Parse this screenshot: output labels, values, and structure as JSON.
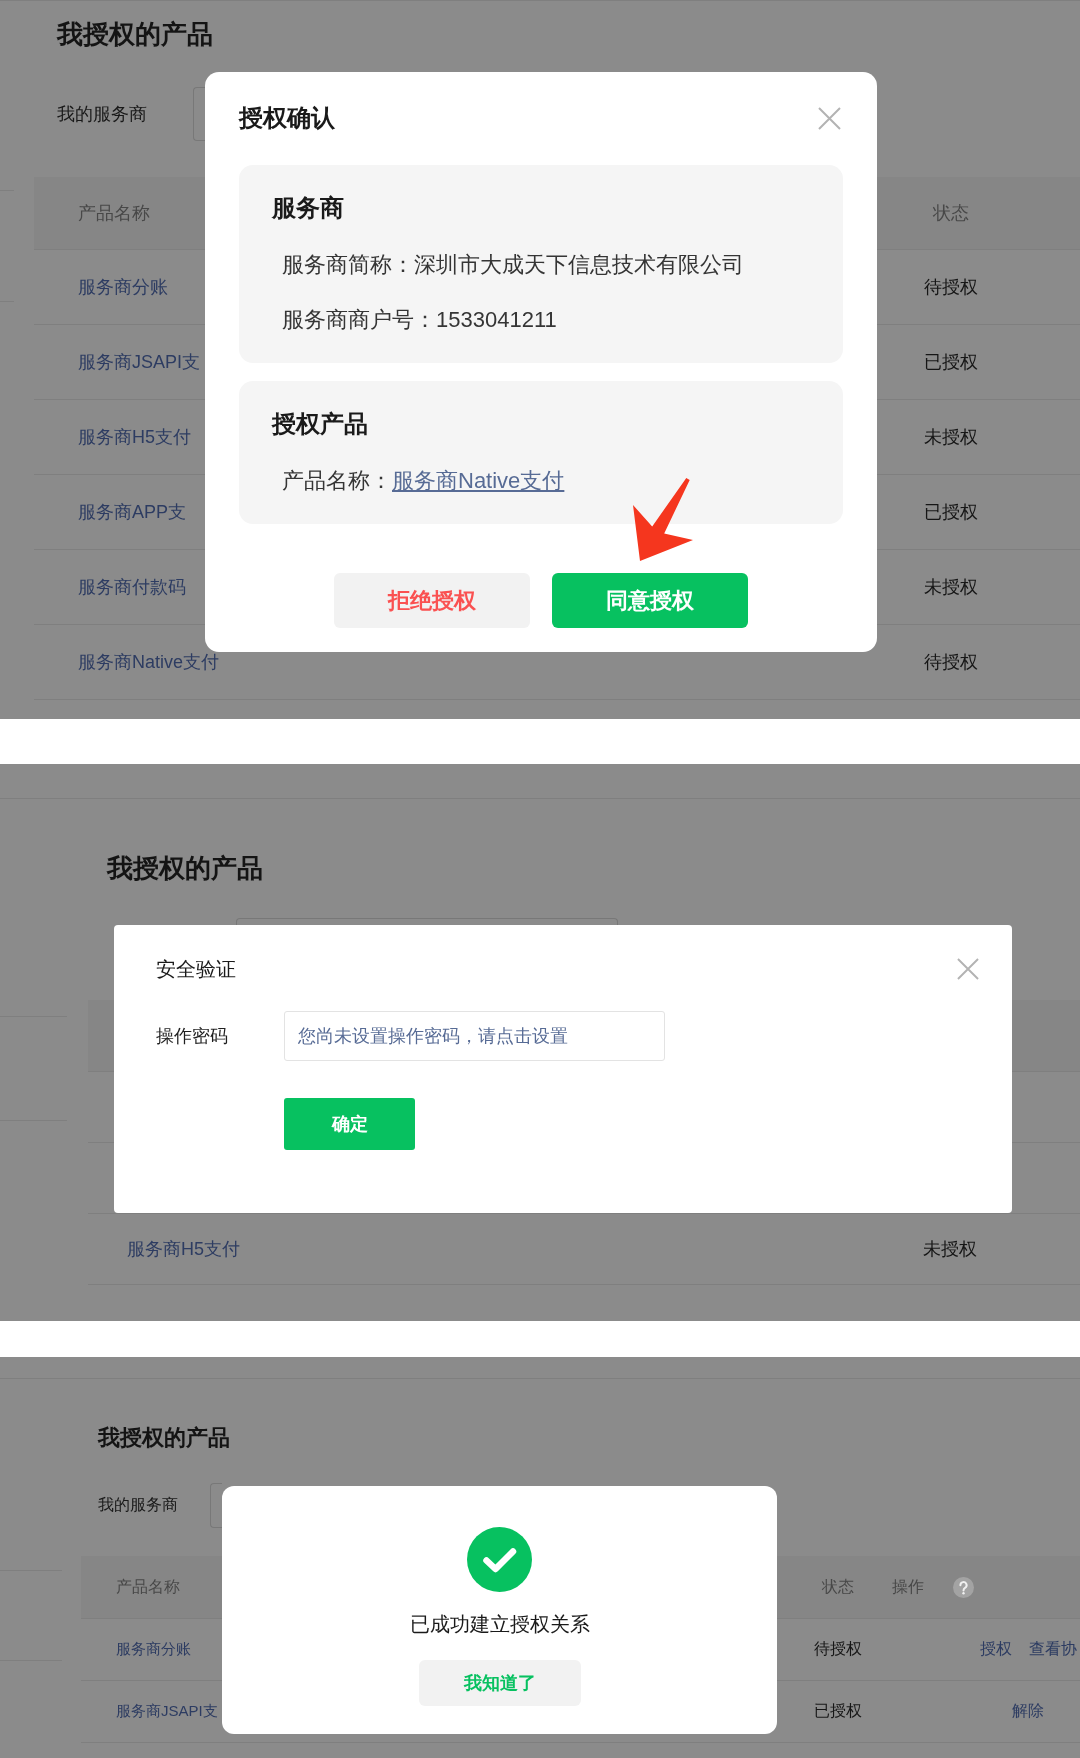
{
  "screens": [
    {
      "kind": "authorize",
      "page": {
        "title": "我授权的产品",
        "filter_label": "我的服务商",
        "columns": [
          {
            "label": "产品名称",
            "help": false
          },
          {
            "label": "状态",
            "help": false
          }
        ],
        "rows": [
          {
            "product": "服务商分账",
            "status": "待授权"
          },
          {
            "product": "服务商JSAPI支",
            "status": "已授权"
          },
          {
            "product": "服务商H5支付",
            "status": "未授权"
          },
          {
            "product": "服务商APP支",
            "status": "已授权"
          },
          {
            "product": "服务商付款码",
            "status": "未授权"
          },
          {
            "product": "服务商Native支付",
            "status": "待授权"
          }
        ]
      },
      "dialog": {
        "title": "授权确认",
        "sections": [
          {
            "heading": "服务商",
            "lines": [
              {
                "label": "服务商简称：",
                "value": "深圳市大成天下信息技术有限公司",
                "kind": "text"
              },
              {
                "label": "服务商商户号：",
                "value": "1533041211",
                "kind": "text"
              }
            ]
          },
          {
            "heading": "授权产品",
            "lines": [
              {
                "label": "产品名称：",
                "value": "服务商Native支付",
                "kind": "link"
              }
            ]
          }
        ],
        "buttons": [
          {
            "label": "拒绝授权",
            "kind": "reject"
          },
          {
            "label": "同意授权",
            "kind": "primary"
          }
        ]
      }
    },
    {
      "kind": "verify",
      "page": {
        "title": "我授权的产品",
        "rows": [
          {
            "product": "服务商H5支付",
            "status": "未授权"
          }
        ]
      },
      "dialog": {
        "title": "安全验证",
        "field_label": "操作密码",
        "field_link": "您尚未设置操作密码，请点击设置",
        "button": "确定"
      }
    },
    {
      "kind": "success",
      "page": {
        "title": "我授权的产品",
        "filter_label": "我的服务商",
        "columns": [
          {
            "label": "产品名称",
            "help": false
          },
          {
            "label": "状态",
            "help": false
          },
          {
            "label": "操作",
            "help": true
          }
        ],
        "rows": [
          {
            "product": "服务商分账",
            "status": "待授权",
            "actions": [
              "授权",
              "查看协"
            ]
          },
          {
            "product": "服务商JSAPI支",
            "status": "已授权",
            "actions": [
              "解除"
            ]
          }
        ]
      },
      "dialog": {
        "message": "已成功建立授权关系",
        "button": "我知道了"
      }
    }
  ]
}
